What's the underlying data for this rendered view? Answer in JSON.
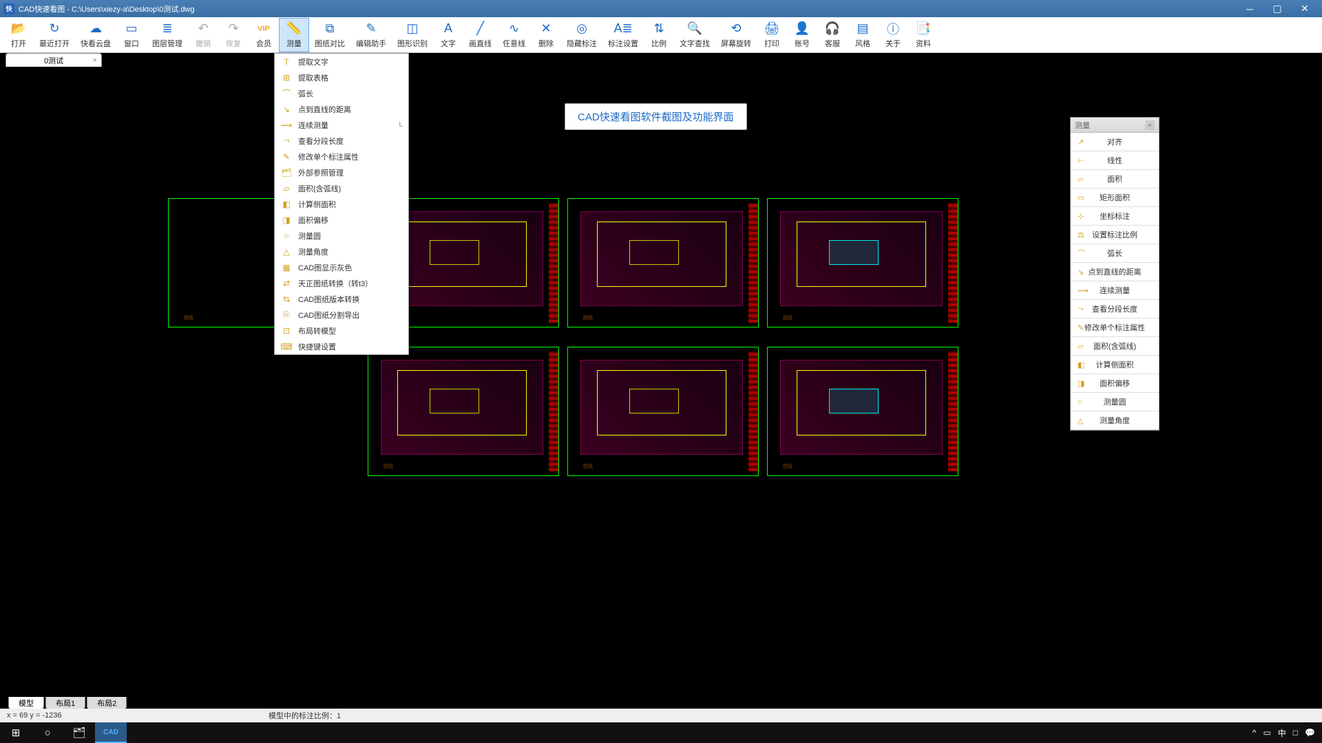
{
  "titlebar": {
    "app_badge": "快",
    "title": "CAD快速看图 - C:\\Users\\xiezy-a\\Desktop\\0测试.dwg"
  },
  "toolbar": [
    {
      "id": "open",
      "label": "打开",
      "icon": "📂"
    },
    {
      "id": "recent",
      "label": "最近打开",
      "icon": "↻"
    },
    {
      "id": "cloud",
      "label": "快看云盘",
      "icon": "☁"
    },
    {
      "id": "window",
      "label": "窗口",
      "icon": "▭"
    },
    {
      "id": "layers",
      "label": "图层管理",
      "icon": "≣"
    },
    {
      "id": "undo",
      "label": "撤销",
      "icon": "↶",
      "disabled": true
    },
    {
      "id": "redo",
      "label": "恢复",
      "icon": "↷",
      "disabled": true
    },
    {
      "id": "vip",
      "label": "会员",
      "icon": "VIP"
    },
    {
      "id": "measure",
      "label": "测量",
      "icon": "📏",
      "active": true
    },
    {
      "id": "compare",
      "label": "图纸对比",
      "icon": "⧉"
    },
    {
      "id": "edit-helper",
      "label": "编辑助手",
      "icon": "✎"
    },
    {
      "id": "shape-recog",
      "label": "图形识别",
      "icon": "◫"
    },
    {
      "id": "text",
      "label": "文字",
      "icon": "A"
    },
    {
      "id": "line",
      "label": "画直线",
      "icon": "╱"
    },
    {
      "id": "freeline",
      "label": "任意线",
      "icon": "∿"
    },
    {
      "id": "delete",
      "label": "删除",
      "icon": "✕"
    },
    {
      "id": "hide-dim",
      "label": "隐藏标注",
      "icon": "◎"
    },
    {
      "id": "dim-settings",
      "label": "标注设置",
      "icon": "A≣"
    },
    {
      "id": "scale",
      "label": "比例",
      "icon": "⇅"
    },
    {
      "id": "find-text",
      "label": "文字查找",
      "icon": "🔍"
    },
    {
      "id": "screen-rotate",
      "label": "屏幕旋转",
      "icon": "⟲"
    },
    {
      "id": "print",
      "label": "打印",
      "icon": "🖨"
    },
    {
      "id": "account",
      "label": "账号",
      "icon": "👤"
    },
    {
      "id": "support",
      "label": "客服",
      "icon": "🎧"
    },
    {
      "id": "style",
      "label": "风格",
      "icon": "▤"
    },
    {
      "id": "about",
      "label": "关于",
      "icon": "ⓘ"
    },
    {
      "id": "resources",
      "label": "资料",
      "icon": "📑"
    }
  ],
  "file_tab": {
    "label": "0测试",
    "close": "×"
  },
  "dropdown": [
    {
      "label": "提取文字",
      "icon": "T"
    },
    {
      "label": "提取表格",
      "icon": "⊞"
    },
    {
      "label": "弧长",
      "icon": "⌒"
    },
    {
      "label": "点到直线的距离",
      "icon": "↘"
    },
    {
      "label": "连续测量",
      "icon": "⟿",
      "shortcut": "L"
    },
    {
      "label": "查看分段长度",
      "icon": "⤳"
    },
    {
      "label": "修改单个标注属性",
      "icon": "✎"
    },
    {
      "label": "外部参照管理",
      "icon": "🗂"
    },
    {
      "label": "面积(含弧线)",
      "icon": "▱"
    },
    {
      "label": "计算侧面积",
      "icon": "◧"
    },
    {
      "label": "面积偏移",
      "icon": "◨"
    },
    {
      "label": "测量圆",
      "icon": "○"
    },
    {
      "label": "测量角度",
      "icon": "△"
    },
    {
      "label": "CAD图显示灰色",
      "icon": "▦"
    },
    {
      "label": "天正图纸转换（转t3）",
      "icon": "⇄"
    },
    {
      "label": "CAD图纸版本转换",
      "icon": "⇆"
    },
    {
      "label": "CAD图纸分割导出",
      "icon": "⎘"
    },
    {
      "label": "布局转模型",
      "icon": "⊡"
    },
    {
      "label": "快捷键设置",
      "icon": "⌨"
    }
  ],
  "side_panel": {
    "header": "测量",
    "items": [
      {
        "label": "对齐",
        "icon": "↗"
      },
      {
        "label": "线性",
        "icon": "⊢"
      },
      {
        "label": "面积",
        "icon": "▱"
      },
      {
        "label": "矩形面积",
        "icon": "▭"
      },
      {
        "label": "坐标标注",
        "icon": "⊹"
      },
      {
        "label": "设置标注比例",
        "icon": "⚖"
      },
      {
        "label": "弧长",
        "icon": "⌒"
      },
      {
        "label": "点到直线的距离",
        "icon": "↘"
      },
      {
        "label": "连续测量",
        "icon": "⟿"
      },
      {
        "label": "查看分段长度",
        "icon": "⤳"
      },
      {
        "label": "修改单个标注属性",
        "icon": "✎"
      },
      {
        "label": "面积(含弧线)",
        "icon": "▱"
      },
      {
        "label": "计算侧面积",
        "icon": "◧"
      },
      {
        "label": "面积偏移",
        "icon": "◨"
      },
      {
        "label": "测量圆",
        "icon": "○"
      },
      {
        "label": "测量角度",
        "icon": "△"
      }
    ]
  },
  "banner": "CAD快速看图软件截图及功能界面",
  "layout_tabs": [
    "模型",
    "布局1",
    "布局2"
  ],
  "status": {
    "coords": "x = 69  y = -1236",
    "ratio": "模型中的标注比例：1"
  },
  "taskbar_tray": [
    "^",
    "▭",
    "中",
    "□",
    "💬"
  ]
}
